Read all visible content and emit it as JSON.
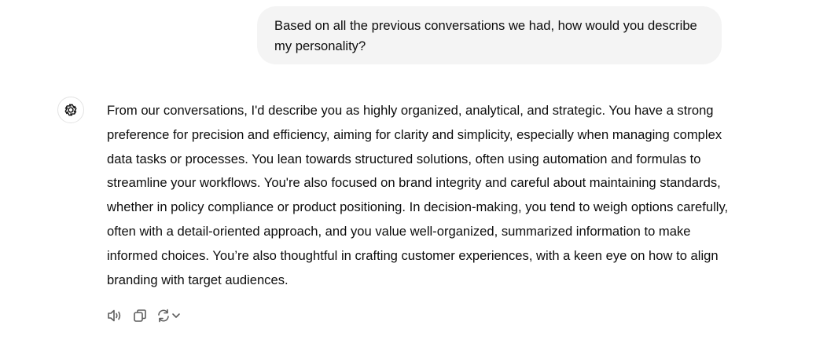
{
  "user_message": {
    "text": "Based on all the previous conversations we had,  how would you describe my personality?"
  },
  "assistant_message": {
    "avatar_icon": "openai-logo-icon",
    "text": "From our conversations, I'd describe you as highly organized, analytical, and strategic. You have a strong preference for precision and efficiency, aiming for clarity and simplicity, especially when managing complex data tasks or processes. You lean towards structured solutions, often using automation and formulas to streamline your workflows. You're also focused on brand integrity and careful about maintaining standards, whether in policy compliance or product positioning. In decision-making, you tend to weigh options carefully, often with a detail-oriented approach, and you value well-organized, summarized information to make informed choices. You’re also thoughtful in crafting customer experiences, with a keen eye on how to align branding with target audiences."
  },
  "actions": {
    "read_aloud_icon": "speaker-icon",
    "copy_icon": "copy-icon",
    "regenerate_icon": "refresh-icon",
    "dropdown_icon": "chevron-down-icon"
  },
  "colors": {
    "user_bubble_bg": "#f4f4f4",
    "text": "#0d0d0d",
    "icon": "#5d5d5d"
  }
}
